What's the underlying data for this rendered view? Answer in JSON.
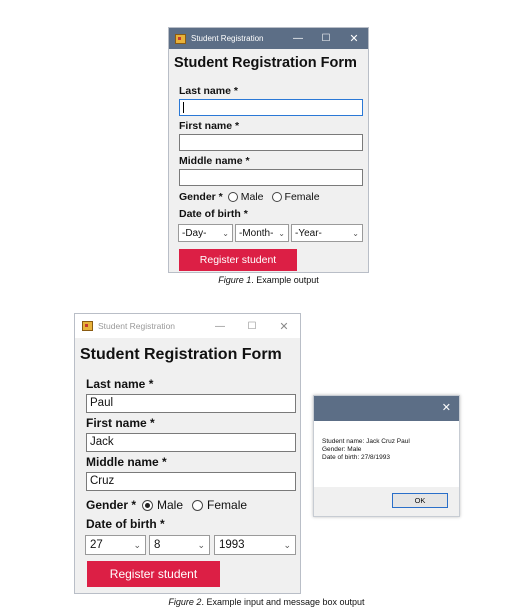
{
  "fig1": {
    "window_title": "Student Registration",
    "form_title": "Student Registration Form",
    "last_name_label": "Last name *",
    "last_name_value": "",
    "first_name_label": "First name *",
    "first_name_value": "",
    "middle_name_label": "Middle name *",
    "middle_name_value": "",
    "gender_label": "Gender *",
    "male_label": "Male",
    "female_label": "Female",
    "dob_label": "Date of birth *",
    "day_value": "-Day-",
    "month_value": "-Month-",
    "year_value": "-Year-",
    "register_label": "Register student",
    "caption_italic": "Figure 1",
    "caption_rest": ". Example output"
  },
  "fig2": {
    "window_title": "Student Registration",
    "form_title": "Student Registration Form",
    "last_name_label": "Last name *",
    "last_name_value": "Paul",
    "first_name_label": "First name *",
    "first_name_value": "Jack",
    "middle_name_label": "Middle name *",
    "middle_name_value": "Cruz",
    "gender_label": "Gender *",
    "male_label": "Male",
    "female_label": "Female",
    "gender_selected": "Male",
    "dob_label": "Date of birth *",
    "day_value": "27",
    "month_value": "8",
    "year_value": "1993",
    "register_label": "Register student",
    "caption_italic": "Figure 2",
    "caption_rest": ". Example input and message box output"
  },
  "msgbox": {
    "line1": "Student name: Jack Cruz Paul",
    "line2": "Gender: Male",
    "line3": "Date of birth: 27/8/1993",
    "ok_label": "OK"
  },
  "icons": {
    "minimize": "minimize-icon",
    "maximize": "maximize-icon",
    "close": "close-icon",
    "dropdown": "chevron-down-icon",
    "app": "app-icon"
  },
  "colors": {
    "titlebar_active": "#5c6e86",
    "titlebar_inactive": "#ffffff",
    "register_button": "#dc1f45",
    "ok_border": "#2a6fc9"
  }
}
